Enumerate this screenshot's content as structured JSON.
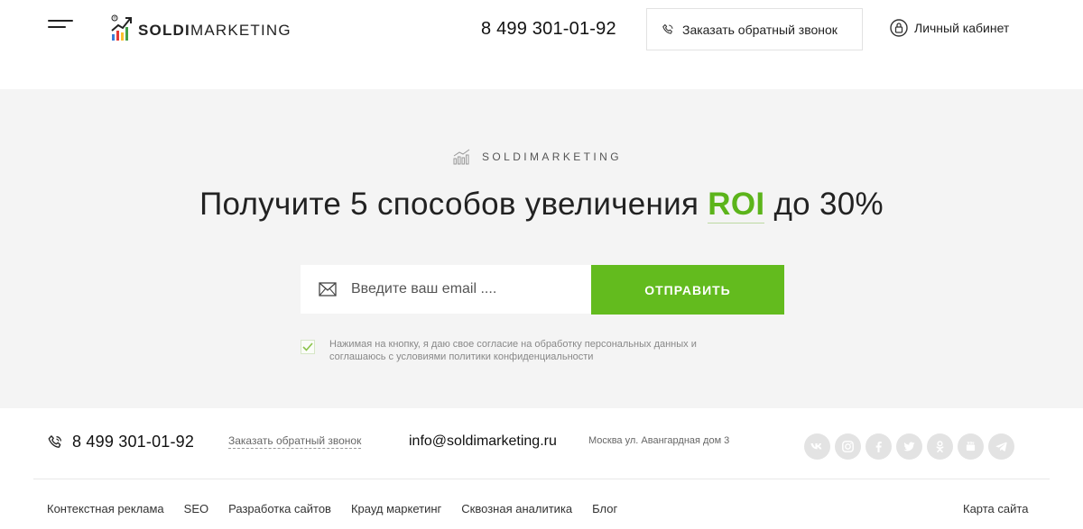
{
  "header": {
    "logo": {
      "bold": "SOLDI",
      "light": "MARKETING",
      "registered_mark": "®"
    },
    "phone": "8 499 301-01-92",
    "callback_label": "Заказать обратный звонок",
    "cabinet_label": "Личный кабинет"
  },
  "hero": {
    "brand_label": "SOLDIMARKETING",
    "headline_before": "Получите 5 способов увеличения ",
    "headline_accent": "ROI",
    "headline_after": " до 30%",
    "email_placeholder": "Введите ваш email ....",
    "email_value": "",
    "submit_label": "ОТПРАВИТЬ",
    "consent_checked": true,
    "consent_text": "Нажимая на кнопку, я даю свое согласие на обработку персональных данных и соглашаюсь с условиями политики конфиденциальности"
  },
  "footer": {
    "phone": "8 499 301-01-92",
    "callback_label": "Заказать обратный звонок",
    "email": "info@soldimarketing.ru",
    "address": "Москва ул. Авангардная дом 3",
    "socials": [
      "vk-icon",
      "instagram-icon",
      "facebook-icon",
      "twitter-icon",
      "odnoklassniki-icon",
      "youtube-icon",
      "telegram-icon"
    ],
    "nav": [
      {
        "label": "Контекстная реклама"
      },
      {
        "label": "SEO"
      },
      {
        "label": "Разработка сайтов"
      },
      {
        "label": "Крауд маркетинг"
      },
      {
        "label": "Сквозная аналитика"
      },
      {
        "label": "Блог"
      }
    ],
    "sitemap_label": "Карта сайта"
  },
  "colors": {
    "accent": "#63bb1e",
    "hero_bg": "#f4f4f4",
    "social_bg": "#e3e3e3"
  }
}
